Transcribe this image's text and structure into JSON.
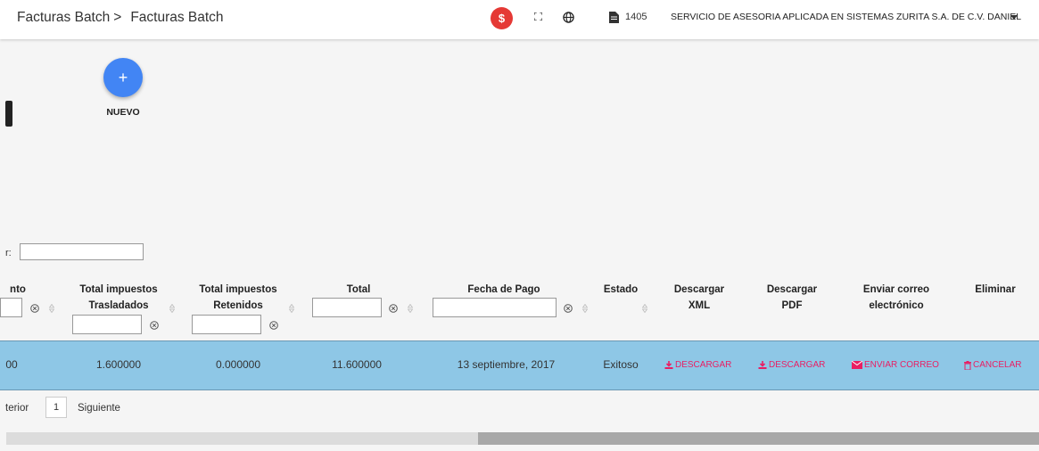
{
  "header": {
    "breadcrumb_root": "Facturas Batch",
    "breadcrumb_sep": ">",
    "breadcrumb_current": "Facturas Batch",
    "dollar_label": "$",
    "doc_count": "1405",
    "company": "SERVICIO DE ASESORIA APLICADA EN SISTEMAS ZURITA S.A. DE C.V. DANIEL",
    "icons": [
      "dollar-icon",
      "fullscreen-icon",
      "globe-icon",
      "document-icon",
      "caret-down-icon"
    ]
  },
  "actions": {
    "new_symbol": "+",
    "new_label": "NUEVO"
  },
  "search": {
    "label": "r:",
    "value": ""
  },
  "table": {
    "columns": [
      "nto",
      "Total impuestos Trasladados",
      "Total impuestos Retenidos",
      "Total",
      "Fecha de Pago",
      "Estado",
      "Descargar XML",
      "Descargar PDF",
      "Enviar correo electrónico",
      "Eliminar"
    ],
    "rows": [
      {
        "monto": "00",
        "trasladados": "1.600000",
        "retenidos": "0.000000",
        "total": "11.600000",
        "fecha": "13 septiembre, 2017",
        "estado": "Exitoso",
        "xml": "DESCARGAR",
        "pdf": "DESCARGAR",
        "correo": "ENVIAR CORREO",
        "eliminar": "CANCELAR"
      }
    ]
  },
  "pager": {
    "prev": "terior",
    "page": "1",
    "next": "Siguiente"
  },
  "colors": {
    "accent": "#4285f4",
    "alert": "#e53935",
    "link": "#e91e63",
    "row_highlight": "#8ec7e6"
  }
}
